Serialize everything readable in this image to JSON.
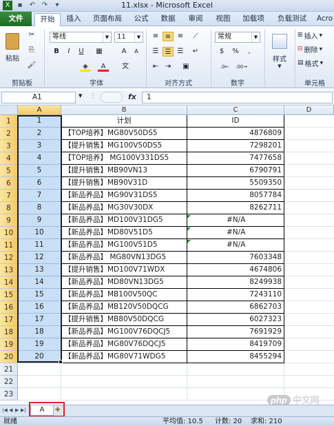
{
  "window": {
    "title": "11.xlsx - Microsoft Excel"
  },
  "tabs": [
    "文件",
    "开始",
    "插入",
    "页面布局",
    "公式",
    "数据",
    "审阅",
    "视图",
    "加载项",
    "负载测试",
    "Acro"
  ],
  "ribbon": {
    "clipboard": {
      "paste_label": "粘贴",
      "group_label": "剪贴板"
    },
    "font": {
      "font_name": "等线",
      "font_size": "11",
      "group_label": "字体"
    },
    "alignment": {
      "group_label": "对齐方式"
    },
    "number": {
      "format": "常规",
      "group_label": "数字"
    },
    "styles": {
      "label": "样式"
    },
    "cells": {
      "insert_label": "插入",
      "delete_label": "删除",
      "format_label": "格式",
      "group_label": "单元格"
    }
  },
  "formula_bar": {
    "name_box": "A1",
    "fx": "fx",
    "value": "1"
  },
  "columns": [
    "A",
    "B",
    "C",
    "D"
  ],
  "header_row": {
    "a": "1",
    "b": "计划",
    "c": "ID"
  },
  "rows": [
    {
      "num": "2",
      "a": "2",
      "b": "【TOP培养】MG80V50DS5",
      "c": "4876809",
      "na": false
    },
    {
      "num": "3",
      "a": "3",
      "b": "【提升销售】MG100V50DS5",
      "c": "7298201",
      "na": false
    },
    {
      "num": "4",
      "a": "4",
      "b": "【TOP培养】 MG100V331DS5",
      "c": "7477658",
      "na": false
    },
    {
      "num": "5",
      "a": "5",
      "b": "【提升销售】MB90VN13",
      "c": "6790791",
      "na": false
    },
    {
      "num": "6",
      "a": "6",
      "b": "【提升销售】MB90V31D",
      "c": "5509350",
      "na": false
    },
    {
      "num": "7",
      "a": "7",
      "b": "【新品养品】MG90V31DS5",
      "c": "8057784",
      "na": false
    },
    {
      "num": "8",
      "a": "8",
      "b": "【新品养品】MG30V30DX",
      "c": "8262711",
      "na": false
    },
    {
      "num": "9",
      "a": "9",
      "b": "【新品养品】MD100V31DG5",
      "c": "#N/A",
      "na": true
    },
    {
      "num": "10",
      "a": "10",
      "b": "【新品养品】MD80V51D5",
      "c": "#N/A",
      "na": true
    },
    {
      "num": "11",
      "a": "11",
      "b": "【新品养品】MG100V51D5",
      "c": "#N/A",
      "na": true
    },
    {
      "num": "12",
      "a": "12",
      "b": "【新品养品】    MG80VN13DG5",
      "c": "7603348",
      "na": false
    },
    {
      "num": "13",
      "a": "13",
      "b": "【提升销售】MD100V71WDX",
      "c": "4674806",
      "na": false
    },
    {
      "num": "14",
      "a": "14",
      "b": "【新品养品】MD80VN13DG5",
      "c": "8249938",
      "na": false
    },
    {
      "num": "15",
      "a": "15",
      "b": "【新品养品】MB100V50QC",
      "c": "7243110",
      "na": false
    },
    {
      "num": "16",
      "a": "16",
      "b": "【新品养品】MB120V50DQCG",
      "c": "6862703",
      "na": false
    },
    {
      "num": "17",
      "a": "17",
      "b": "【提升销售】MB80V50DQCG",
      "c": "6027323",
      "na": false
    },
    {
      "num": "18",
      "a": "18",
      "b": "【新品养品】MG100V76DQCJ5",
      "c": "7691929",
      "na": false
    },
    {
      "num": "19",
      "a": "19",
      "b": "【新品养品】MG80V76DQCJ5",
      "c": "8419709",
      "na": false
    },
    {
      "num": "20",
      "a": "20",
      "b": "【新品养品】MG80V71WDG5",
      "c": "8455294",
      "na": false
    }
  ],
  "empty_rows": [
    "21",
    "22",
    "23"
  ],
  "sheets": [
    "A"
  ],
  "status": {
    "ready": "就绪",
    "average": "平均值: 10.5",
    "count": "计数: 20",
    "sum": "求和: 210"
  },
  "watermark": {
    "logo": "php",
    "text": "中文网"
  }
}
